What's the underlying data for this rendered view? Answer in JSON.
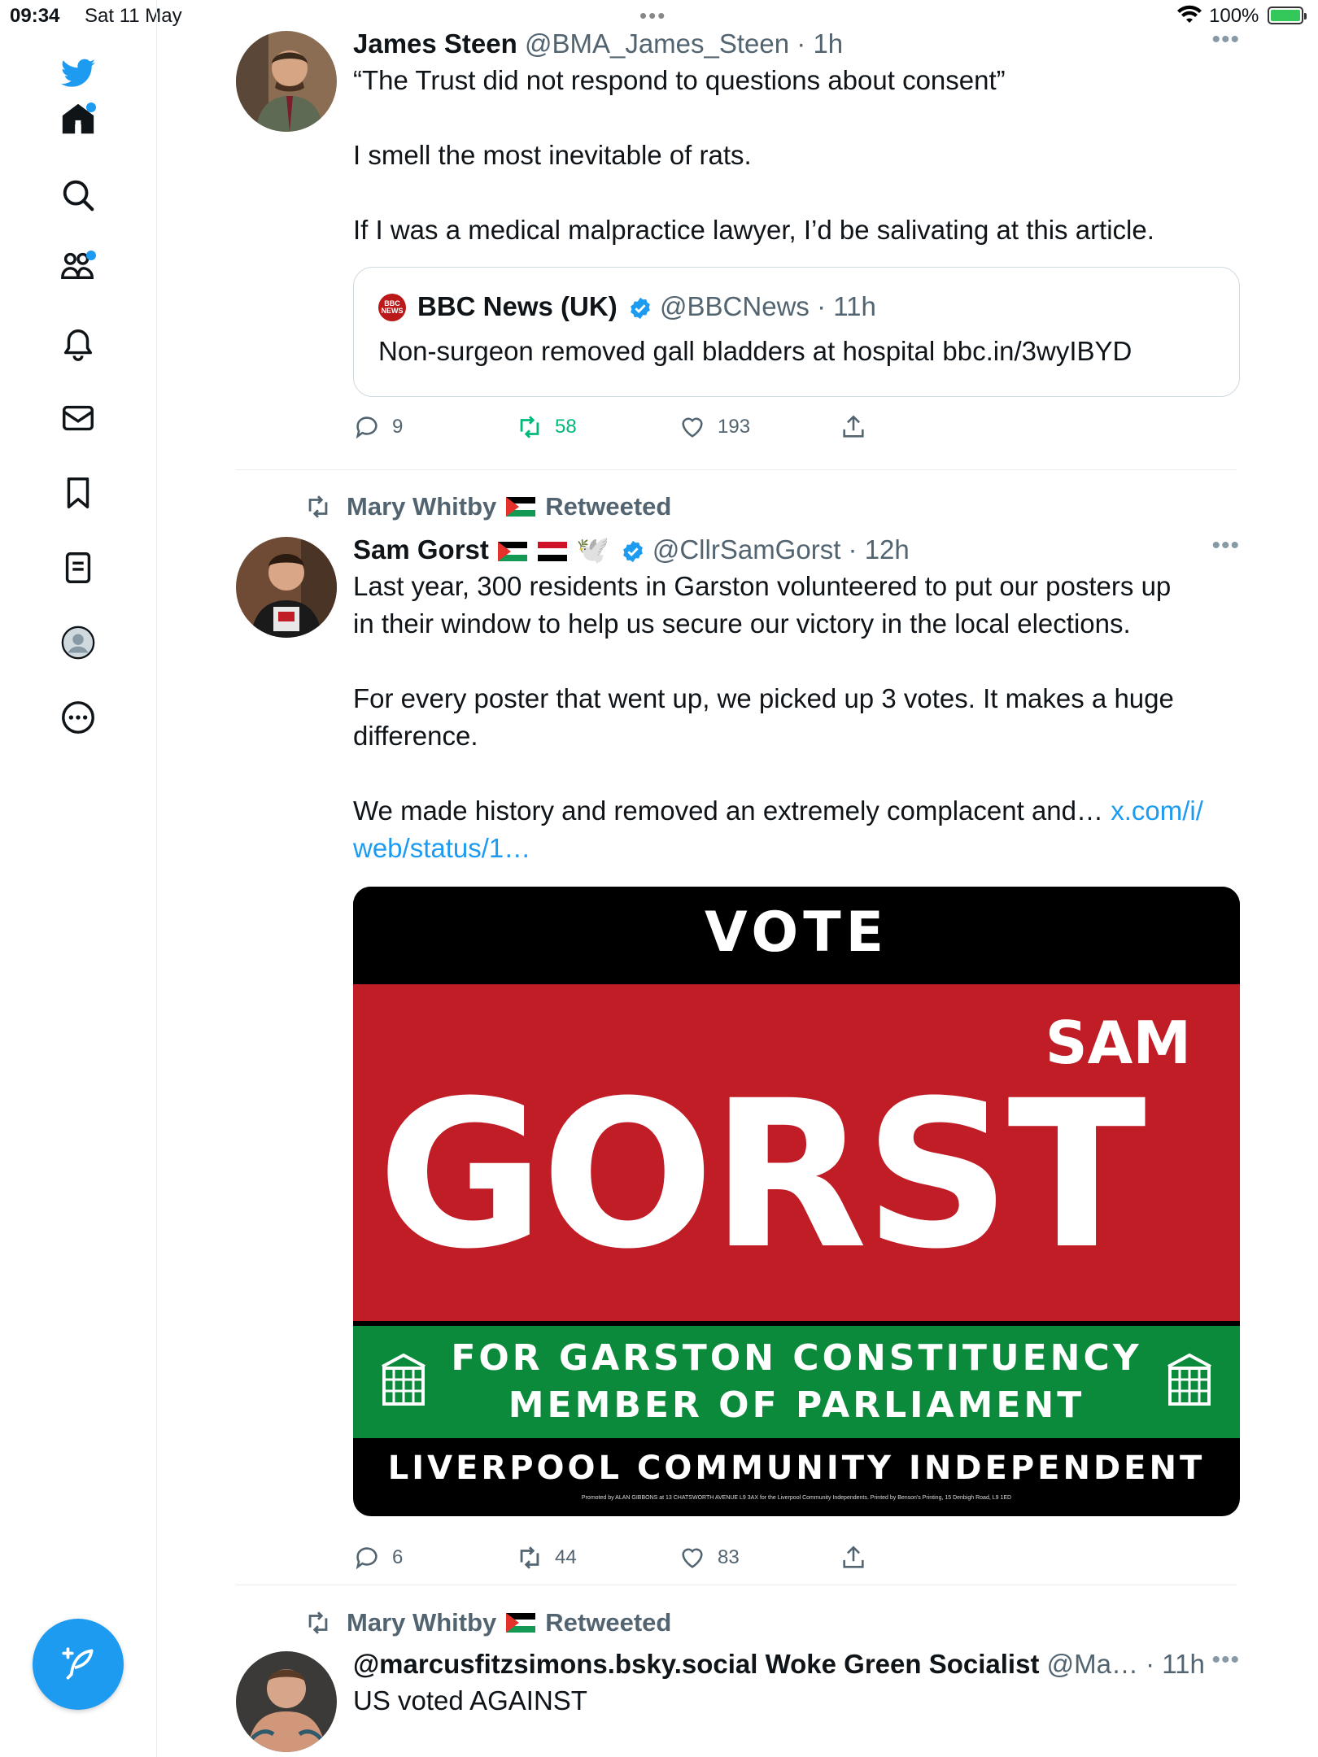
{
  "status_bar": {
    "time": "09:34",
    "date": "Sat 11 May",
    "battery": "100%"
  },
  "sidebar": {
    "items": [
      {
        "name": "home"
      },
      {
        "name": "explore"
      },
      {
        "name": "communities"
      },
      {
        "name": "notifications"
      },
      {
        "name": "messages"
      },
      {
        "name": "bookmarks"
      },
      {
        "name": "lists"
      },
      {
        "name": "profile"
      },
      {
        "name": "more"
      }
    ]
  },
  "tweets": [
    {
      "name": "James Steen",
      "handle": "@BMA_James_Steen",
      "time": "· 1h",
      "lines": [
        "“The Trust did not respond to questions about consent”",
        "I smell the most inevitable of rats.",
        "If I was a medical malpractice lawyer, I’d be salivating at this article."
      ],
      "quote": {
        "name": "BBC News (UK)",
        "handle": "@BBCNews",
        "time": "· 11h",
        "text": "Non-surgeon removed gall bladders at hospital bbc.in/3wyIBYD",
        "logo": "BBC NEWS"
      },
      "replies": "9",
      "retweets": "58",
      "likes": "193"
    },
    {
      "retweeted_by": "Mary Whitby",
      "retweeted_label": "Retweeted",
      "name": "Sam Gorst",
      "handle": "@CllrSamGorst",
      "time": "· 12h",
      "dove": "🕊️",
      "line1": "Last year, 300 residents in Garston volunteered to put our posters up",
      "line2": "in their window to help us secure our victory in the local elections.",
      "line3": "For every poster that went up, we picked up 3 votes. It makes a huge",
      "line4": "difference.",
      "line5": "We made history and removed an extremely complacent and…",
      "link1": "x.com/i/",
      "link2": "web/status/1…",
      "poster": {
        "vote": "VOTE",
        "first_name": "SAM",
        "surname": "GORST",
        "line1": "FOR GARSTON CONSTITUENCY",
        "line2": "MEMBER OF PARLIAMENT",
        "party": "LIVERPOOL COMMUNITY INDEPENDENT",
        "imprint": "Promoted by ALAN GIBBONS at 13 CHATSWORTH AVENUE L9 3AX for the Liverpool Community Independents. Printed by Benson's Printing, 15 Denbigh Road, L9 1ED"
      },
      "replies": "6",
      "retweets": "44",
      "likes": "83"
    },
    {
      "retweeted_by": "Mary Whitby",
      "retweeted_label": "Retweeted",
      "name": "@marcusfitzsimons.bsky.social Woke Green Socialist",
      "handle": "@Ma…",
      "time": "· 11h",
      "text": "US voted AGAINST"
    }
  ],
  "colors": {
    "accent": "#1d9bf0",
    "retweet_green": "#00ba7c",
    "poster_red": "#c01d27",
    "poster_green": "#0a8a3a"
  }
}
